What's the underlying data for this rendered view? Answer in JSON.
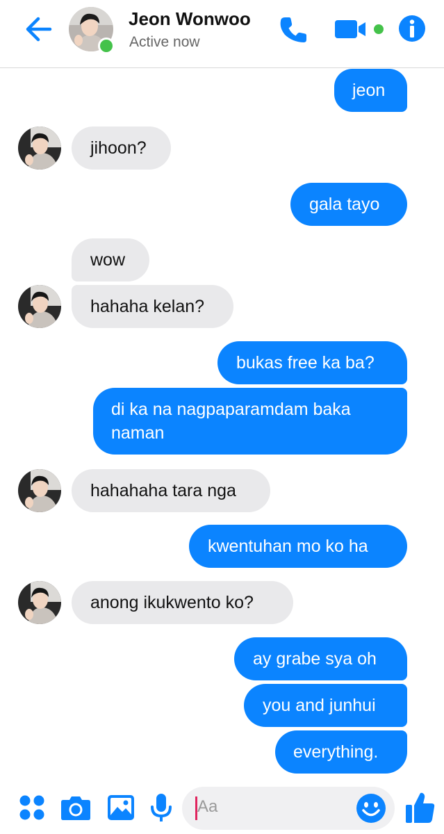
{
  "header": {
    "contact_name": "Jeon Wonwoo",
    "status": "Active now",
    "icons": [
      "back-arrow-icon",
      "phone-icon",
      "video-camera-icon",
      "info-icon"
    ]
  },
  "colors": {
    "accent": "#0b84ff",
    "incoming_bubble": "#e9e9eb",
    "active_green": "#44c24a"
  },
  "messages": [
    {
      "direction": "outgoing",
      "text": "jeon"
    },
    {
      "direction": "incoming",
      "text": "jihoon?"
    },
    {
      "direction": "outgoing",
      "text": "gala tayo"
    },
    {
      "direction": "incoming",
      "text": "wow"
    },
    {
      "direction": "incoming",
      "text": "hahaha kelan?"
    },
    {
      "direction": "outgoing",
      "text": "bukas free ka ba?"
    },
    {
      "direction": "outgoing",
      "text": "di ka na nagpaparamdam baka naman"
    },
    {
      "direction": "incoming",
      "text": "hahahaha tara nga"
    },
    {
      "direction": "outgoing",
      "text": "kwentuhan mo ko ha"
    },
    {
      "direction": "incoming",
      "text": "anong ikukwento ko?"
    },
    {
      "direction": "outgoing",
      "text": "ay grabe sya oh"
    },
    {
      "direction": "outgoing",
      "text": "you and junhui"
    },
    {
      "direction": "outgoing",
      "text": "everything."
    }
  ],
  "composer": {
    "placeholder": "Aa",
    "icons": [
      "apps-icon",
      "camera-icon",
      "image-icon",
      "microphone-icon",
      "emoji-icon",
      "thumbs-up-icon"
    ]
  }
}
